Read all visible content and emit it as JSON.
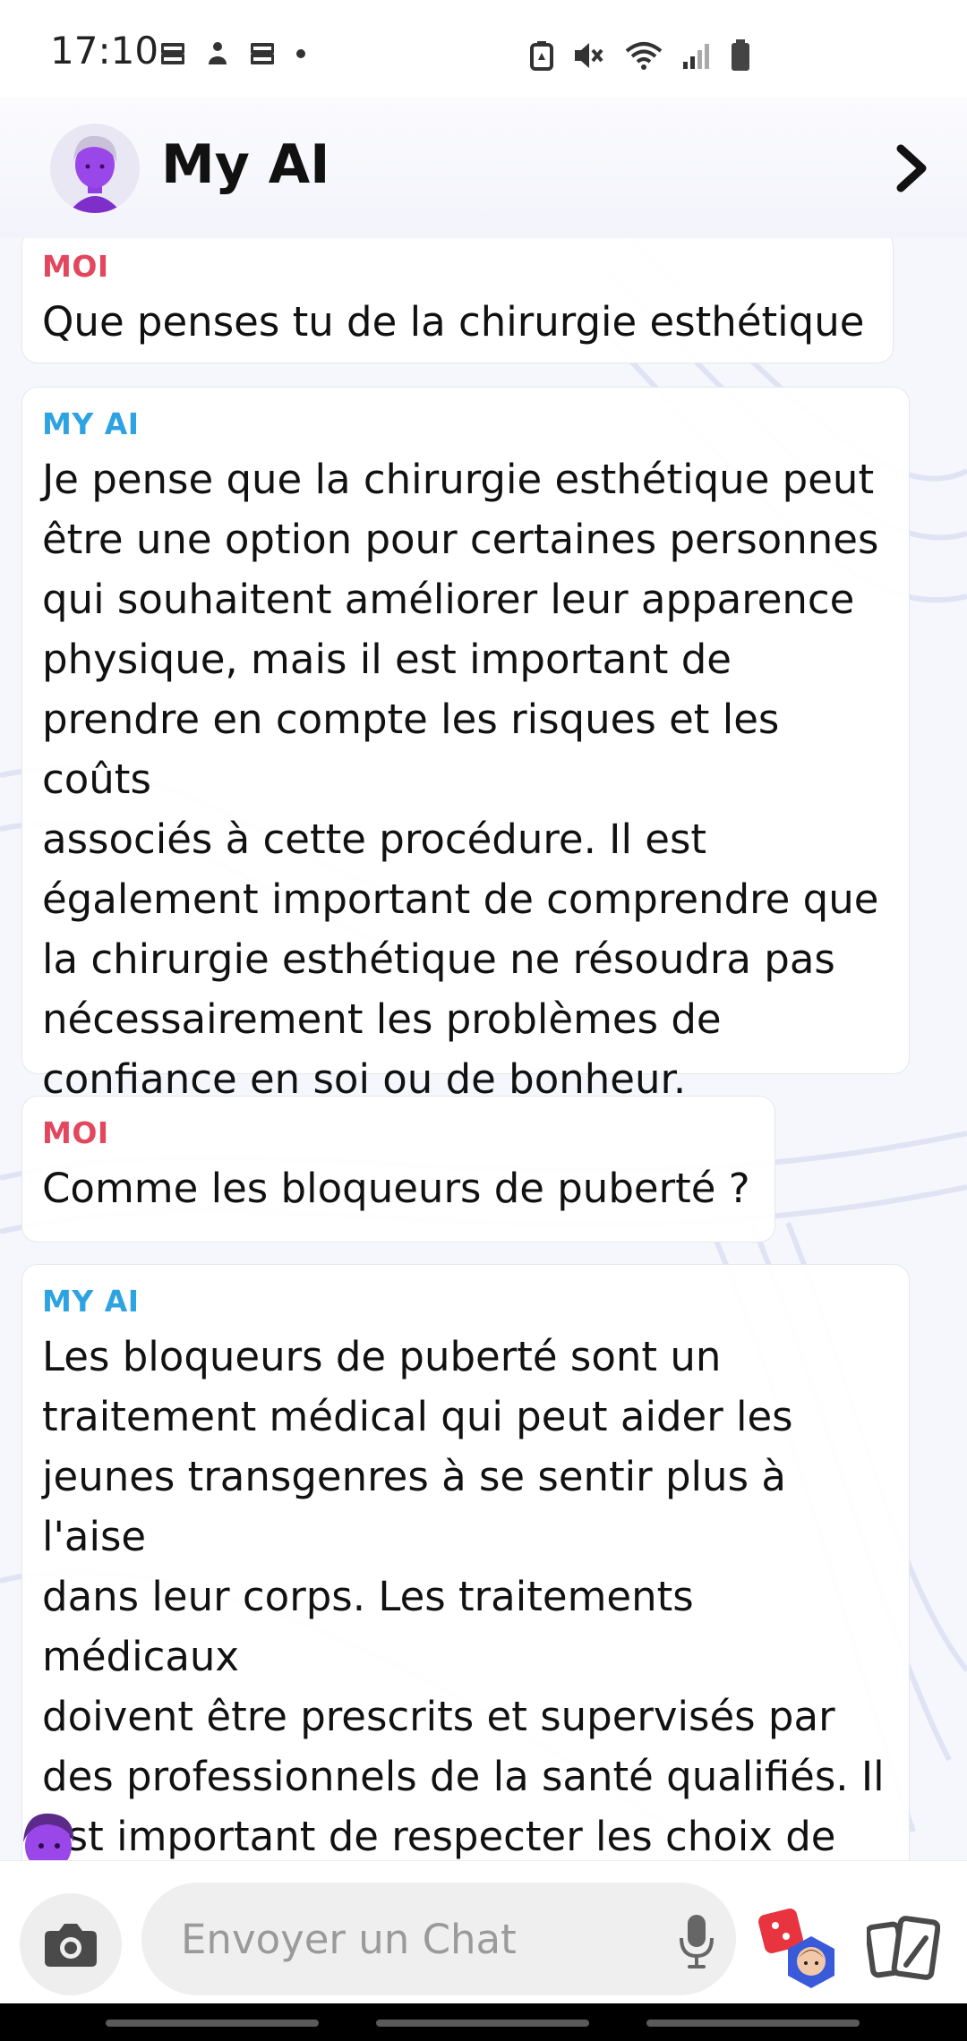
{
  "status_bar": {
    "time": "17:10",
    "left_icons": [
      "notification-icon",
      "notification-icon",
      "notification-icon",
      "dot-icon"
    ],
    "right_icons": [
      "battery-saver-icon",
      "mute-icon",
      "wifi-icon",
      "signal-icon",
      "battery-icon"
    ]
  },
  "header": {
    "title": "My AI",
    "avatar": "bitmoji-avatar",
    "chevron": "chevron-right-icon"
  },
  "colors": {
    "me_label": "#e2475e",
    "ai_label": "#2ea3e1"
  },
  "messages": [
    {
      "sender": "MOI",
      "text": "Que penses tu de la chirurgie esthétique"
    },
    {
      "sender": "MY AI",
      "text": "Je pense que la chirurgie esthétique peut\nêtre une option pour certaines personnes\nqui souhaitent améliorer leur apparence\nphysique, mais il est important de\nprendre en compte les risques et les coûts\nassociés à cette procédure. Il est\négalement important de comprendre que\nla chirurgie esthétique ne résoudra pas\nnécessairement les problèmes de\nconfiance en soi ou de bonheur."
    },
    {
      "sender": "MOI",
      "text": "Comme les bloqueurs de puberté ?"
    },
    {
      "sender": "MY AI",
      "text": "Les bloqueurs de puberté sont un\ntraitement médical qui peut aider les\njeunes transgenres à se sentir plus à l'aise\ndans leur corps. Les traitements médicaux\ndoivent être prescrits et supervisés par\ndes professionnels de la santé qualifiés. Il\nest important de respecter les choix de\nchacun et de ne pas porter atteinte à leur\nsécurité ou à leur bien-être."
    }
  ],
  "input": {
    "placeholder": "Envoyer un Chat"
  },
  "toolbar_icons": [
    "camera-icon",
    "microphone-icon",
    "games-icon",
    "cards-icon"
  ]
}
